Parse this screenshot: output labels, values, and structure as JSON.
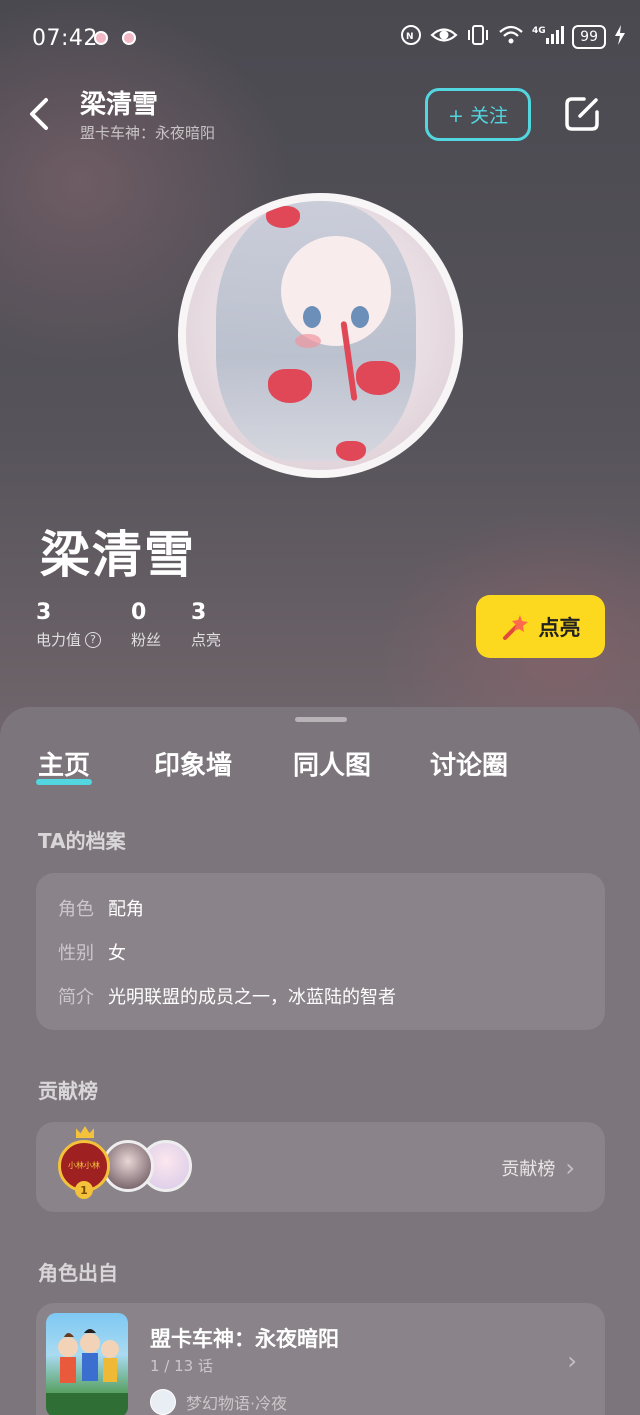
{
  "status_bar": {
    "time": "07:42",
    "battery": "99",
    "icons": [
      "notification-icon",
      "eye-icon",
      "vibrate-icon",
      "wifi-icon",
      "4g-signal-icon",
      "charging-icon"
    ]
  },
  "header": {
    "title": "梁清雪",
    "subtitle": "盟卡车神：永夜暗阳",
    "follow_label": "+ 关注"
  },
  "profile": {
    "name": "梁清雪",
    "stats": [
      {
        "value": "3",
        "label": "电力值"
      },
      {
        "value": "0",
        "label": "粉丝"
      },
      {
        "value": "3",
        "label": "点亮"
      }
    ],
    "light_up_label": "点亮"
  },
  "tabs": [
    {
      "label": "主页",
      "active": true
    },
    {
      "label": "印象墙",
      "active": false
    },
    {
      "label": "同人图",
      "active": false
    },
    {
      "label": "讨论圈",
      "active": false
    }
  ],
  "archive": {
    "title": "TA的档案",
    "rows": [
      {
        "key": "角色",
        "value": "配角"
      },
      {
        "key": "性别",
        "value": "女"
      },
      {
        "key": "简介",
        "value": "光明联盟的成员之一，冰蓝陆的智者"
      }
    ]
  },
  "contribution": {
    "title": "贡献榜",
    "top_rank": "1",
    "top_avatar_text": "小林小林",
    "link_label": "贡献榜"
  },
  "origin": {
    "title": "角色出自",
    "work_title": "盟卡车神：永夜暗阳",
    "progress": "1 / 13 话",
    "author": "梦幻物语·冷夜"
  },
  "colors": {
    "accent": "#52d6df",
    "light_button": "#fcd91f"
  }
}
